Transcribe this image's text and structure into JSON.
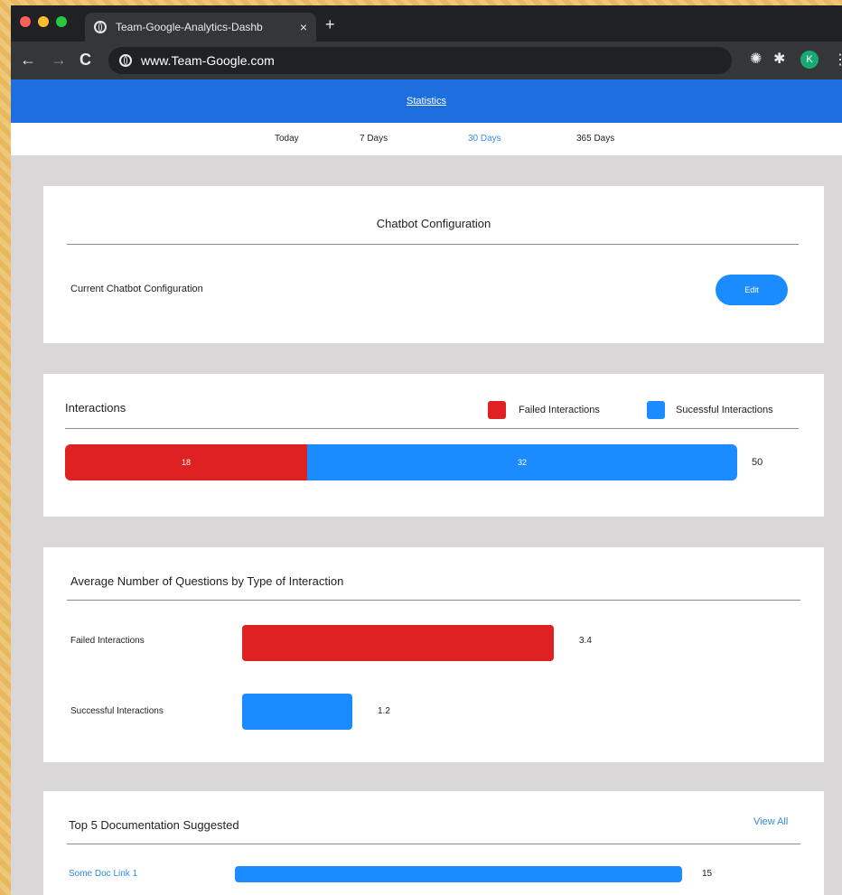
{
  "browser": {
    "tab_title": "Team-Google-Analytics-Dashb",
    "tab_close": "×",
    "new_tab": "+",
    "url": "www.Team-Google.com",
    "avatar_letter": "K",
    "back_glyph": "←",
    "forward_glyph": "→",
    "reload_glyph": "C",
    "menu_glyph": "⋮"
  },
  "header": {
    "title": "Statistics"
  },
  "ranges": {
    "items": [
      "Today",
      "7 Days",
      "30 Days",
      "365 Days"
    ],
    "selected": "30 Days"
  },
  "chatbot": {
    "title": "Chatbot Configuration",
    "label": "Current Chatbot Configuration",
    "edit_label": "Edit"
  },
  "interactions": {
    "title": "Interactions",
    "legend_failed": "Failed Interactions",
    "legend_success": "Sucessful Interactions",
    "failed": 18,
    "successful": 32,
    "total": 50,
    "failed_label": "18",
    "successful_label": "32",
    "total_label": "50"
  },
  "avg_questions": {
    "title": "Average Number of Questions by Type of Interaction",
    "rows": [
      {
        "label": "Failed Interactions",
        "value": 3.4,
        "value_label": "3.4"
      },
      {
        "label": "Successful Interactions",
        "value": 1.2,
        "value_label": "1.2"
      }
    ]
  },
  "top_docs": {
    "title": "Top 5 Documentation Suggested",
    "view_all": "View All",
    "rows": [
      {
        "label": "Some Doc Link 1",
        "value": 15,
        "value_label": "15"
      }
    ]
  },
  "colors": {
    "failed": "#df2121",
    "success": "#1a8cff",
    "header_blue": "#1d6fe0"
  }
}
